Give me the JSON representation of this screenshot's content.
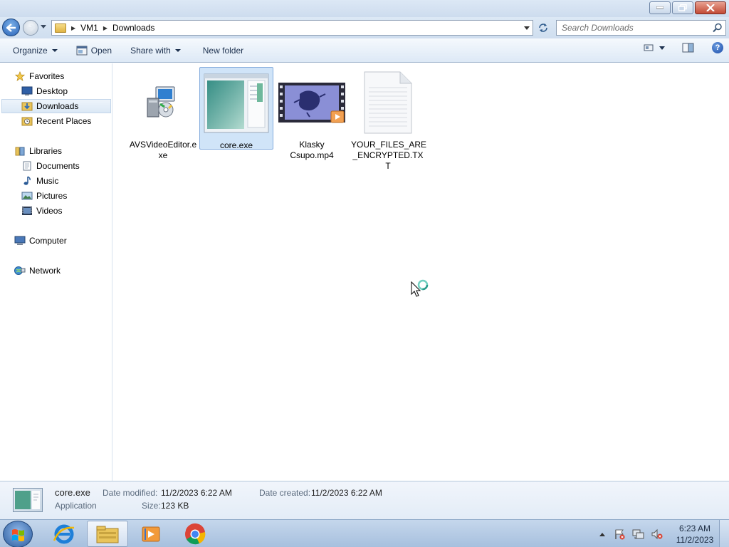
{
  "navbar": {
    "breadcrumbs": [
      "VM1",
      "Downloads"
    ],
    "search_placeholder": "Search Downloads"
  },
  "toolbar": {
    "organize": "Organize",
    "open": "Open",
    "share_with": "Share with",
    "new_folder": "New folder"
  },
  "sidebar": {
    "favorites": "Favorites",
    "favorites_items": [
      "Desktop",
      "Downloads",
      "Recent Places"
    ],
    "libraries": "Libraries",
    "libraries_items": [
      "Documents",
      "Music",
      "Pictures",
      "Videos"
    ],
    "computer": "Computer",
    "network": "Network",
    "selected": "Downloads"
  },
  "files": [
    {
      "name": "AVSVideoEditor.exe",
      "name_lines": [
        "AVSVideoEditor.e",
        "xe"
      ],
      "icon": "installer-icon"
    },
    {
      "name": "core.exe",
      "name_lines": [
        "core.exe"
      ],
      "icon": "application-icon",
      "selected": true
    },
    {
      "name": "Klasky Csupo.mp4",
      "name_lines": [
        "Klasky",
        "Csupo.mp4"
      ],
      "icon": "video-thumbnail"
    },
    {
      "name": "YOUR_FILES_ARE_ENCRYPTED.TXT",
      "name_lines": [
        "YOUR_FILES_ARE",
        "_ENCRYPTED.TX",
        "T"
      ],
      "icon": "text-document-icon"
    }
  ],
  "details": {
    "name": "core.exe",
    "type": "Application",
    "modified_label": "Date modified:",
    "modified_value": "11/2/2023 6:22 AM",
    "size_label": "Size:",
    "size_value": "123 KB",
    "created_label": "Date created:",
    "created_value": "11/2/2023 6:22 AM"
  },
  "taskbar": {
    "apps": [
      "internet-explorer-icon",
      "windows-explorer-icon",
      "media-player-icon",
      "chrome-icon"
    ],
    "time": "6:23 AM",
    "date": "11/2/2023"
  }
}
